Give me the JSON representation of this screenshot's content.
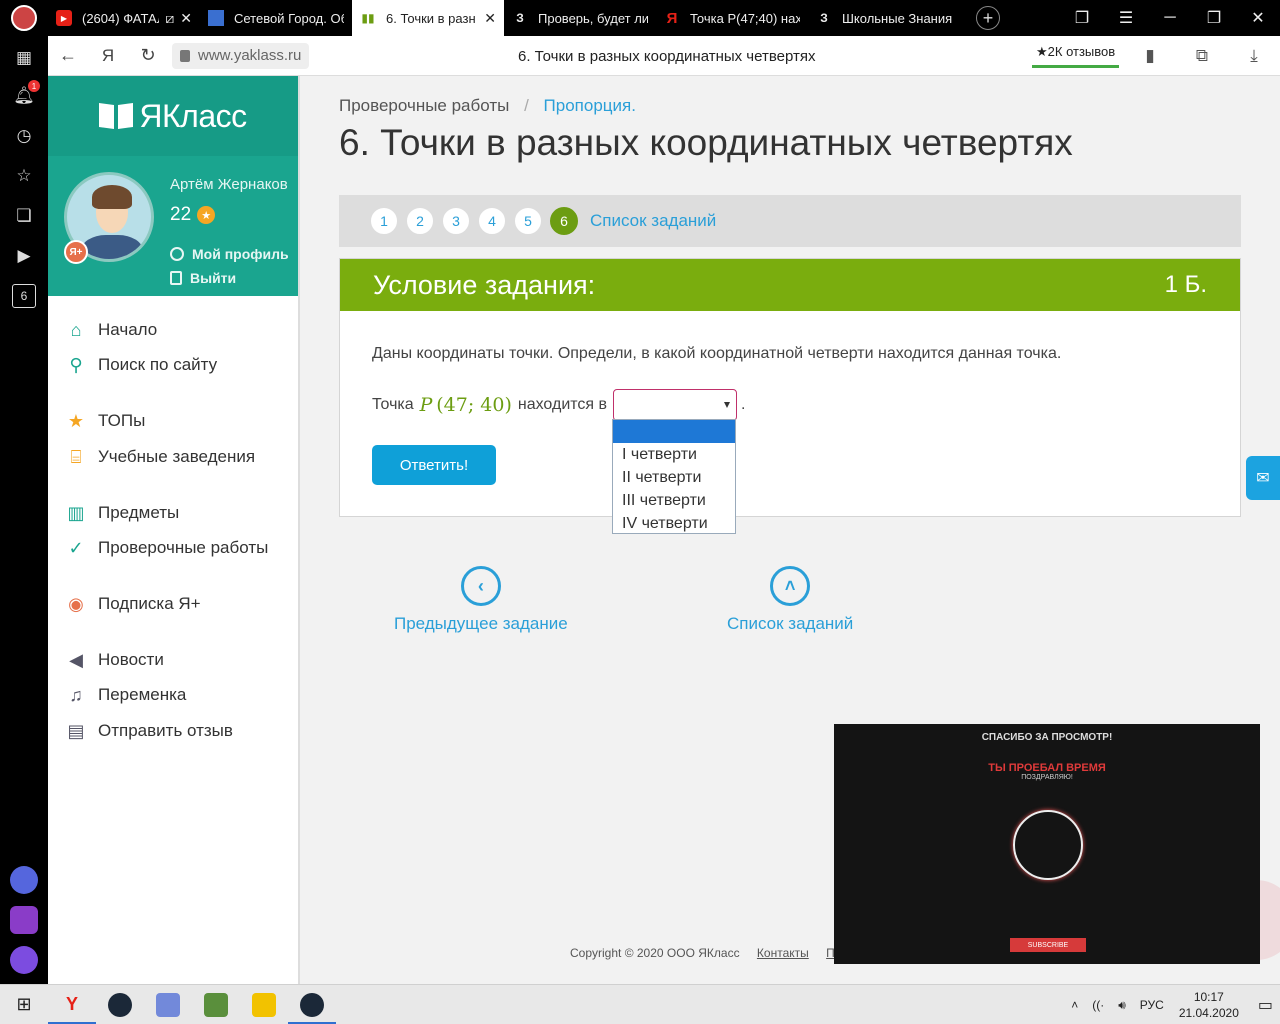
{
  "browser": {
    "tabs": [
      {
        "title": "(2604) ФАТАЛ",
        "favicon": "youtube-icon",
        "color": "#e62117"
      },
      {
        "title": "Сетевой Город. Об",
        "favicon": "netcity-icon",
        "color": "#3a6fd0"
      },
      {
        "title": "6. Точки в разн",
        "favicon": "yaklass-icon",
        "color": "#6c9d12"
      },
      {
        "title": "Проверь, будет ли",
        "favicon": "znanija-icon",
        "color": "#ffffff"
      },
      {
        "title": "Точка P(47;40) нах",
        "favicon": "yandex-icon",
        "color": "#e62117"
      },
      {
        "title": "Школьные Знания",
        "favicon": "znanija-icon",
        "color": "#ffffff"
      }
    ],
    "url": "www.yaklass.ru",
    "page_title": "6. Точки в разных координатных четвертях",
    "reviews": "★2К отзывов",
    "notification_count": "1",
    "rail_counter": "6"
  },
  "site": {
    "logo_text": "ЯКласс",
    "user": {
      "name": "Артём Жернаков",
      "points": "22",
      "profile_link": "Мой профиль",
      "logout_link": "Выйти",
      "plus_badge": "Я+"
    },
    "menu": [
      {
        "label": "Начало",
        "icon": "home-icon",
        "color": "#1aa58f"
      },
      {
        "label": "Поиск по сайту",
        "icon": "search-icon",
        "color": "#1aa58f"
      },
      {
        "label": "ТОПы",
        "icon": "star-icon",
        "color": "#f5a623"
      },
      {
        "label": "Учебные заведения",
        "icon": "school-icon",
        "color": "#f5a623"
      },
      {
        "label": "Предметы",
        "icon": "book-icon",
        "color": "#1aa58f"
      },
      {
        "label": "Проверочные работы",
        "icon": "check-circle-icon",
        "color": "#1aa58f"
      },
      {
        "label": "Подписка Я+",
        "icon": "subscription-icon",
        "color": "#e6704a"
      },
      {
        "label": "Новости",
        "icon": "megaphone-icon",
        "color": "#556"
      },
      {
        "label": "Переменка",
        "icon": "bell-icon",
        "color": "#556"
      },
      {
        "label": "Отправить отзыв",
        "icon": "comment-icon",
        "color": "#556"
      }
    ]
  },
  "main": {
    "breadcrumb": [
      "Проверочные работы",
      "Пропорция."
    ],
    "title": "6. Точки в разных координатных четвертях",
    "pager": {
      "pages": [
        "1",
        "2",
        "3",
        "4",
        "5",
        "6"
      ],
      "active": "6",
      "list_link": "Список заданий"
    },
    "task": {
      "header": "Условие задания:",
      "points": "1 Б.",
      "text": "Даны координаты точки. Определи, в какой координатной четверти находится данная точка.",
      "line_prefix": "Точка",
      "point_name": "P",
      "point_coords": "(47; 40)",
      "line_middle": "находится в",
      "line_suffix": ".",
      "select_value": "",
      "options": [
        "",
        "I четверти",
        "II четверти",
        "III четверти",
        "IV четверти"
      ],
      "submit_label": "Ответить!"
    },
    "prev_label": "Предыдущее задание",
    "list_label": "Список заданий",
    "footer": {
      "copyright": "Copyright © 2020 ООО ЯКласс",
      "contacts": "Контакты",
      "more": "П"
    }
  },
  "video": {
    "line1": "СПАСИБО ЗА ПРОСМОТР!",
    "line2": "ТЫ ПРОЕБАЛ ВРЕМЯ",
    "line3": "ПОЗДРАВЛЯЮ!",
    "subscribe": "SUBSCRIBE"
  },
  "taskbar": {
    "language": "РУС",
    "time": "10:17",
    "date": "21.04.2020"
  }
}
